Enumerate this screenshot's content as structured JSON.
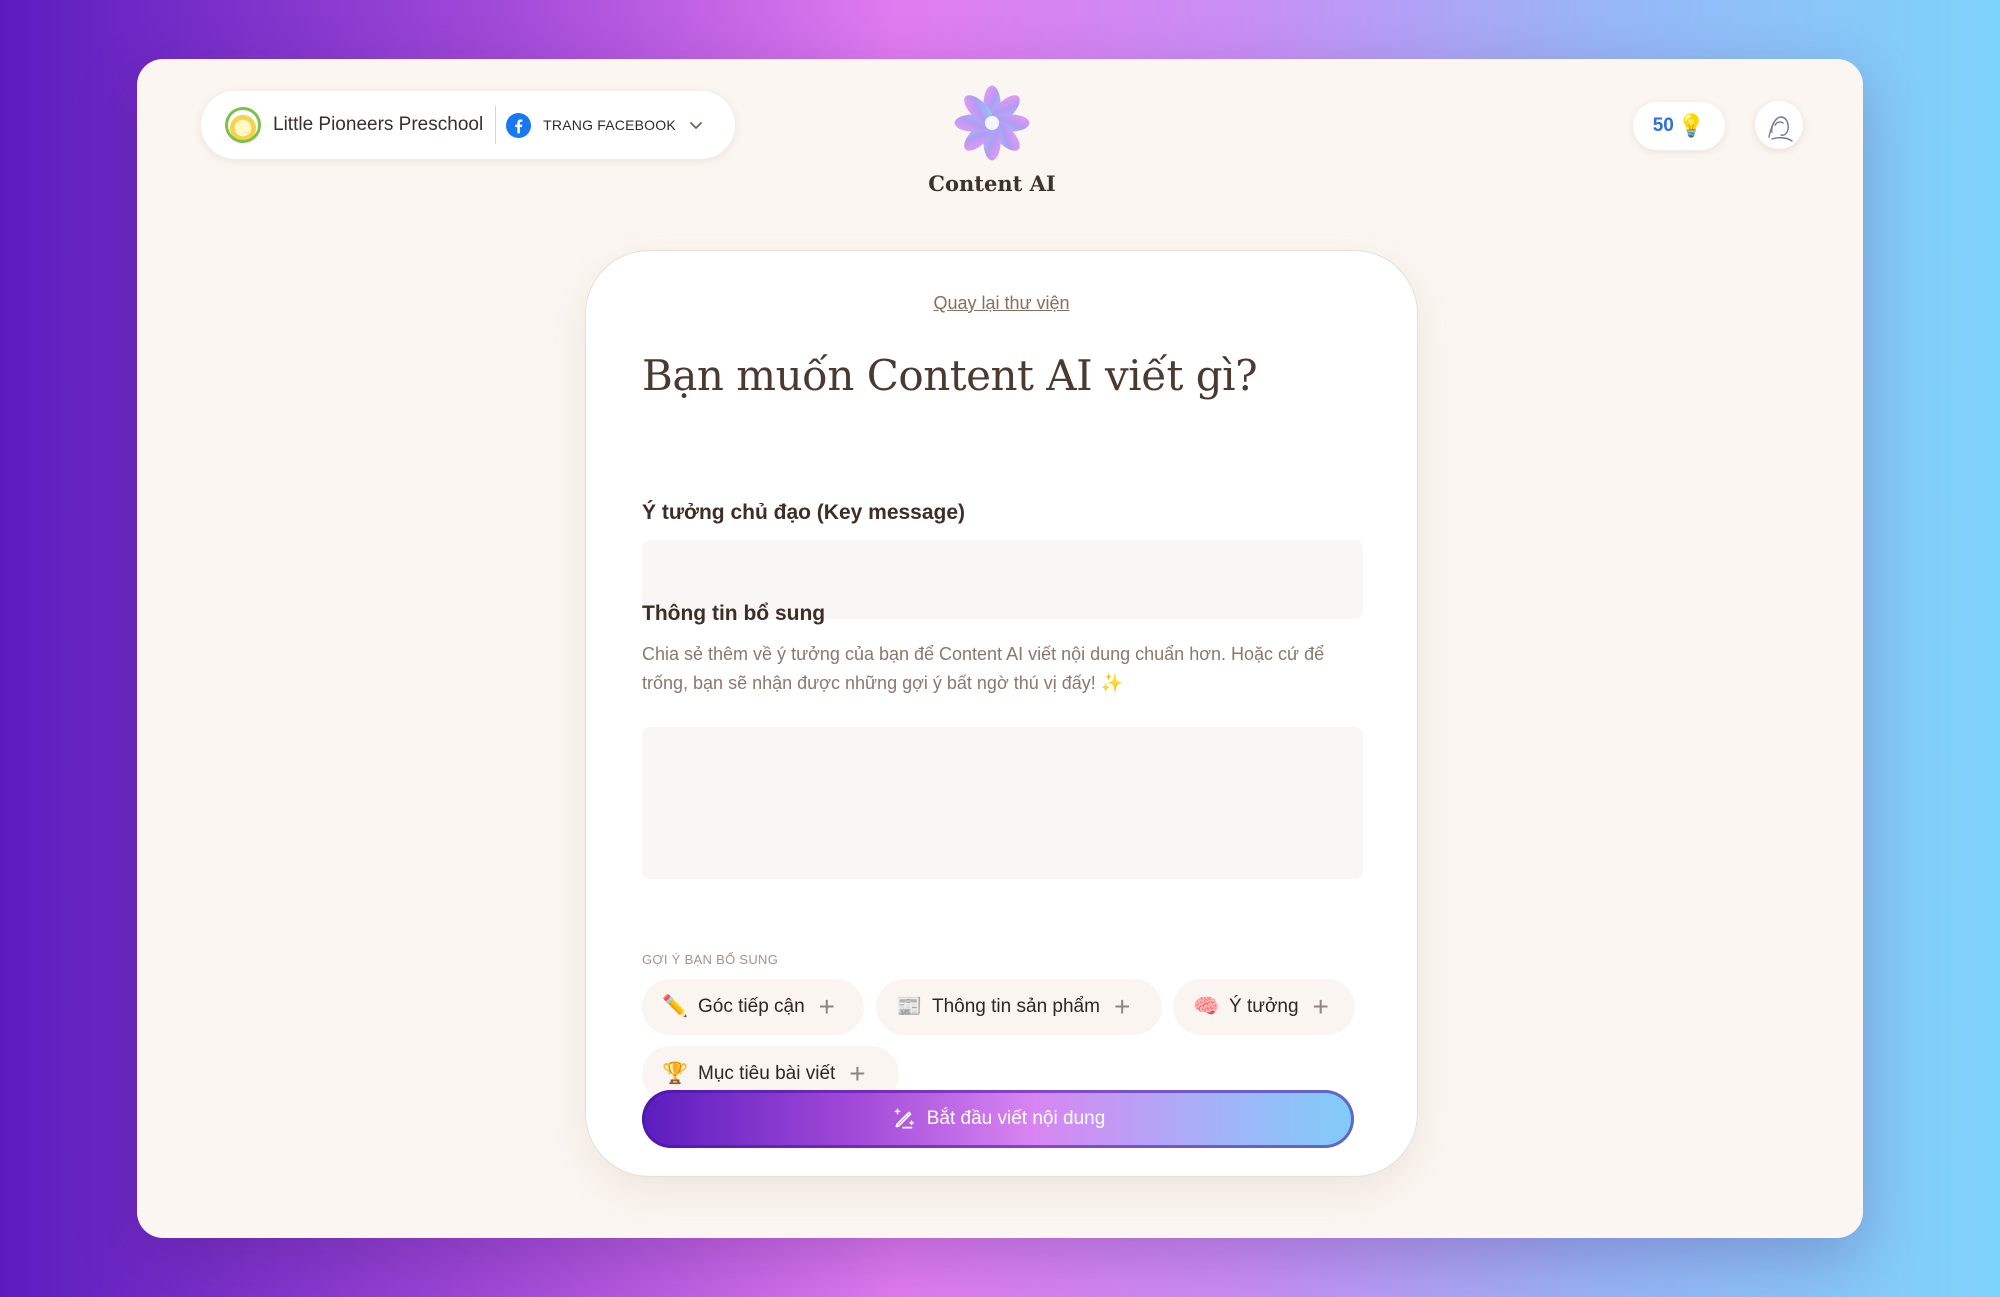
{
  "header": {
    "brand_name": "Little Pioneers Preschool",
    "page_type": "TRANG FACEBOOK",
    "app_title": "Content AI",
    "credits": "50"
  },
  "card": {
    "back_link": "Quay lại thư viện",
    "heading": "Bạn muốn Content AI viết gì?",
    "key_message_label": "Ý tưởng chủ đạo (Key message)",
    "key_message_value": "",
    "extra_info_label": "Thông tin bổ sung",
    "extra_info_helper": "Chia sẻ thêm về ý tưởng của bạn để Content AI viết nội dung chuẩn hơn. Hoặc cứ để trống, bạn sẽ nhận được những gợi ý bất ngờ thú vị đấy! ✨",
    "extra_info_value": "",
    "suggestions_title": "GỢI Ý BẠN BỔ SUNG",
    "suggestions": [
      {
        "emoji": "✏️",
        "label": "Góc tiếp cận"
      },
      {
        "emoji": "📰",
        "label": "Thông tin sản phẩm"
      },
      {
        "emoji": "🧠",
        "label": "Ý tưởng"
      },
      {
        "emoji": "🏆",
        "label": "Mục tiêu bài viết"
      }
    ],
    "cta_label": "Bắt đầu viết nội dung"
  },
  "icons": {
    "brand_logo": "preschool-logo-icon",
    "facebook": "facebook-icon",
    "chevron": "chevron-down-icon",
    "app_logo": "lotus-logo-icon",
    "credits_icon": "lightbulb-icon",
    "avatar": "user-avatar-icon",
    "cta_icon": "magic-pen-icon"
  },
  "colors": {
    "window_bg": "#fbf6f2",
    "card_bg": "#ffffff",
    "credit_text": "#2f6fe0",
    "facebook_blue": "#1877f2",
    "cta_gradient_start": "#5b1cbe",
    "cta_gradient_end": "#7fcdf8"
  }
}
